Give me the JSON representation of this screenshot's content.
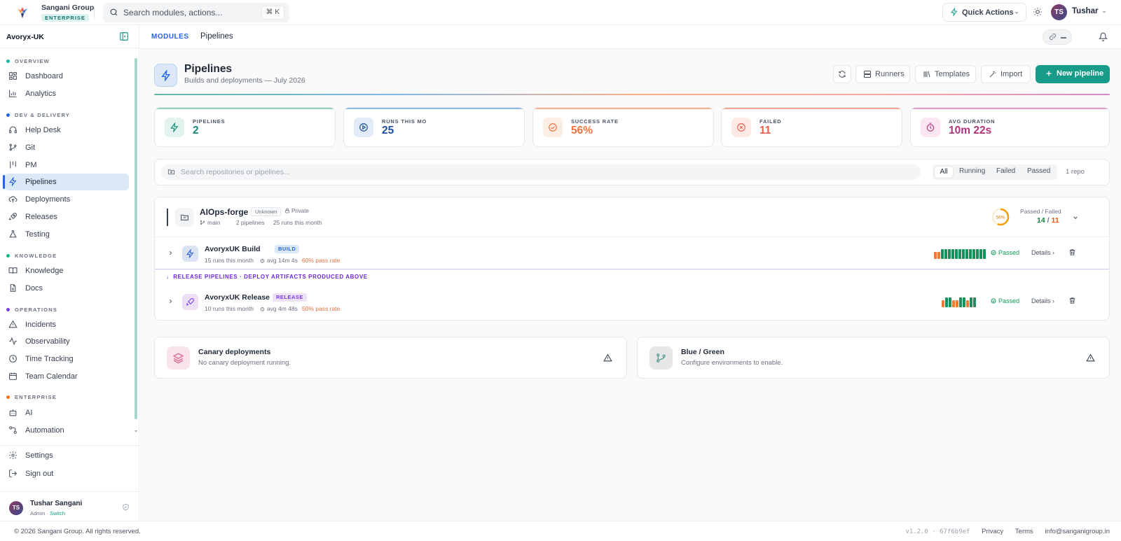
{
  "brand": {
    "name": "Sangani Group",
    "badge": "ENTERPRISE"
  },
  "search": {
    "placeholder": "Search modules, actions...",
    "shortcut": "⌘ K"
  },
  "topbar": {
    "quick_actions": "Quick Actions",
    "user_initials": "TS",
    "user_name": "Tushar"
  },
  "sidebar": {
    "org": "Avoryx-UK",
    "sections": [
      {
        "title": "OVERVIEW",
        "color": "#14b8a6"
      },
      {
        "title": "DEV & DELIVERY",
        "color": "#2563eb"
      },
      {
        "title": "KNOWLEDGE",
        "color": "#10b981"
      },
      {
        "title": "OPERATIONS",
        "color": "#7c3aed"
      },
      {
        "title": "ENTERPRISE",
        "color": "#f97316"
      }
    ],
    "items": [
      {
        "label": "Dashboard",
        "icon": "grid-icon"
      },
      {
        "label": "Analytics",
        "icon": "bar-chart-icon"
      },
      {
        "label": "Help Desk",
        "icon": "headset-icon"
      },
      {
        "label": "Git",
        "icon": "git-branch-icon"
      },
      {
        "label": "PM",
        "icon": "kanban-icon"
      },
      {
        "label": "Pipelines",
        "icon": "zap-icon"
      },
      {
        "label": "Deployments",
        "icon": "cloud-upload-icon"
      },
      {
        "label": "Releases",
        "icon": "rocket-icon"
      },
      {
        "label": "Testing",
        "icon": "flask-icon"
      },
      {
        "label": "Knowledge",
        "icon": "book-icon"
      },
      {
        "label": "Docs",
        "icon": "file-text-icon"
      },
      {
        "label": "Incidents",
        "icon": "alert-triangle-icon"
      },
      {
        "label": "Observability",
        "icon": "activity-icon"
      },
      {
        "label": "Time Tracking",
        "icon": "clock-icon"
      },
      {
        "label": "Team Calendar",
        "icon": "calendar-icon"
      },
      {
        "label": "AI",
        "icon": "bot-icon"
      },
      {
        "label": "Automation",
        "icon": "workflow-icon"
      }
    ],
    "bottom": [
      {
        "label": "Settings",
        "icon": "gear-icon"
      },
      {
        "label": "Sign out",
        "icon": "log-out-icon"
      }
    ],
    "user": {
      "initials": "TS",
      "name": "Tushar Sangani",
      "role": "Admin · ",
      "switch": "Switch"
    }
  },
  "breadcrumb": {
    "module": "MODULES",
    "separator": "/",
    "current": "Pipelines"
  },
  "page": {
    "title": "Pipelines",
    "subtitle": "Builds and deployments — July 2026",
    "buttons": {
      "runners": "Runners",
      "templates": "Templates",
      "import": "Import",
      "new": "New pipeline"
    }
  },
  "stats": [
    {
      "label": "PIPELINES",
      "value": "2",
      "color": "#178a79",
      "bg": "#e3f3ef",
      "bar": "#8fd0c1"
    },
    {
      "label": "RUNS THIS MO",
      "value": "25",
      "color": "#1e4fa0",
      "bg": "#e2ecf8",
      "bar": "#8db8e6"
    },
    {
      "label": "SUCCESS RATE",
      "value": "56%",
      "color": "#f0733f",
      "bg": "#fdeee4",
      "bar": "#f6b08a"
    },
    {
      "label": "FAILED",
      "value": "11",
      "color": "#e5604b",
      "bg": "#fde9e5",
      "bar": "#f4a494"
    },
    {
      "label": "AVG DURATION",
      "value": "10m 22s",
      "color": "#b1327a",
      "bg": "#fbe6f1",
      "bar": "#e29ccc"
    }
  ],
  "filters": {
    "placeholder": "Search repositories or pipelines...",
    "options": [
      "All",
      "Running",
      "Failed",
      "Passed"
    ],
    "count": "1 repo"
  },
  "repo": {
    "name": "AIOps-forge",
    "tag": "Unknown",
    "visibility": "Private",
    "branch": "main",
    "pipelines": "2 pipelines",
    "runs": "25 runs this month",
    "ring_label": "56%",
    "success_rate": 0.56,
    "pf_label": "Passed / Failed",
    "passed": "14",
    "slash": "/",
    "failed": "11",
    "release_divider": "RELEASE PIPELINES · DEPLOY ARTIFACTS PRODUCED ABOVE",
    "pipelines_list": [
      {
        "name": "AvoryxUK Build",
        "badge": "BUILD",
        "runs": "15 runs this month",
        "avg": "avg 14m 4s",
        "rate": "60% pass rate",
        "status": "Passed",
        "details": "Details",
        "history": [
          "f",
          "f",
          "p",
          "p",
          "p",
          "p",
          "p",
          "p",
          "p",
          "p",
          "p",
          "p",
          "p",
          "p",
          "p"
        ]
      },
      {
        "name": "AvoryxUK Release",
        "badge": "RELEASE",
        "runs": "10 runs this month",
        "avg": "avg 4m 48s",
        "rate": "50% pass rate",
        "status": "Passed",
        "details": "Details",
        "history": [
          "f",
          "p",
          "p",
          "f",
          "f",
          "p",
          "p",
          "f",
          "p",
          "p"
        ]
      }
    ]
  },
  "cards": [
    {
      "title": "Canary deployments",
      "subtitle": "No canary deployment running."
    },
    {
      "title": "Blue / Green",
      "subtitle": "Configure environments to enable."
    }
  ],
  "footer": {
    "copyright": "© 2026 Sangani Group. All rights reserved.",
    "version": "v1.2.0 · 67f6b9ef",
    "links": [
      "Privacy",
      "Terms",
      "info@sanganigroup.in"
    ]
  }
}
